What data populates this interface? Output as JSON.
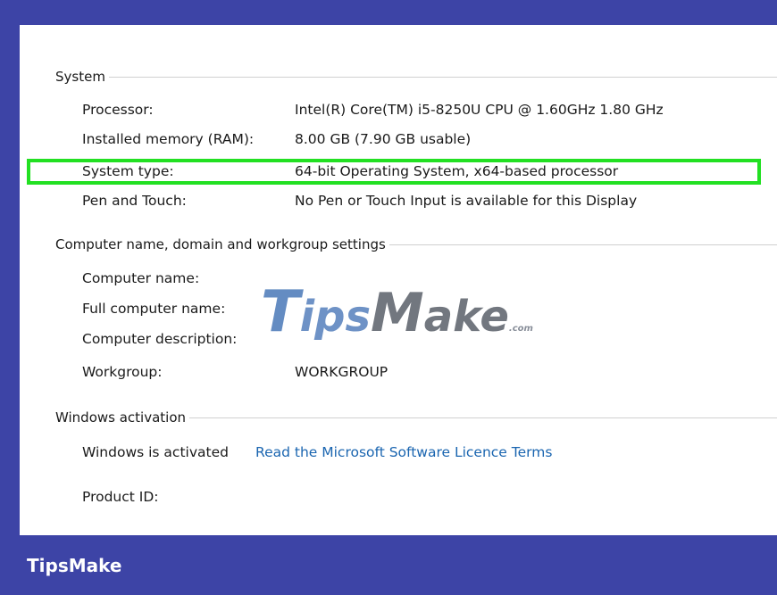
{
  "system": {
    "header": "System",
    "rows": [
      {
        "label": "Processor:",
        "value": "Intel(R) Core(TM) i5-8250U CPU @ 1.60GHz   1.80 GHz"
      },
      {
        "label": "Installed memory (RAM):",
        "value": "8.00 GB (7.90 GB usable)"
      },
      {
        "label": "System type:",
        "value": "64-bit Operating System, x64-based processor"
      },
      {
        "label": "Pen and Touch:",
        "value": "No Pen or Touch Input is available for this Display"
      }
    ]
  },
  "computer": {
    "header": "Computer name, domain and workgroup settings",
    "rows": [
      {
        "label": "Computer name:",
        "value": ""
      },
      {
        "label": "Full computer name:",
        "value": ""
      },
      {
        "label": "Computer description:",
        "value": ""
      },
      {
        "label": "Workgroup:",
        "value": "WORKGROUP"
      }
    ]
  },
  "activation": {
    "header": "Windows activation",
    "status": "Windows is activated",
    "license_link": "Read the Microsoft Software Licence Terms",
    "product_id_label": "Product ID:"
  },
  "watermark": {
    "t": "T",
    "ips": "ips",
    "m": "M",
    "ake": "ake",
    "com": ".com"
  },
  "brand": "TipsMake",
  "colors": {
    "background": "#3d44a6",
    "highlight": "#22e022",
    "link": "#1a65b0"
  }
}
